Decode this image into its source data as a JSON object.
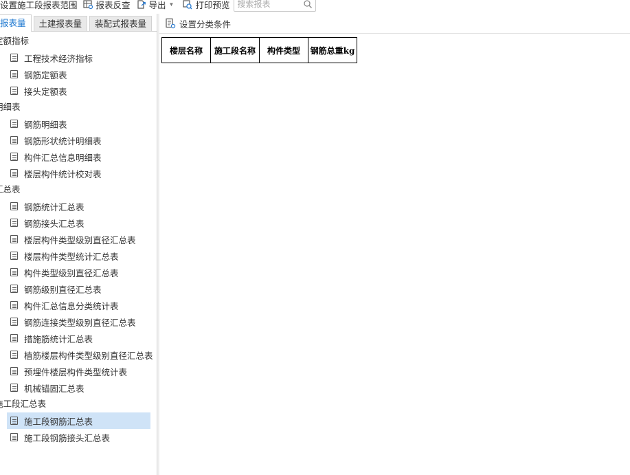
{
  "toolbar": {
    "items": [
      {
        "label": "设置施工段报表范围"
      },
      {
        "label": "报表反查",
        "icon": "grid-search-icon"
      },
      {
        "label": "导出",
        "icon": "export-icon"
      },
      {
        "label": "打印预览",
        "icon": "print-preview-icon"
      }
    ],
    "search_placeholder": "搜索报表"
  },
  "tabs": [
    {
      "label": "报表量",
      "active": true
    },
    {
      "label": "土建报表量",
      "active": false
    },
    {
      "label": "装配式报表量",
      "active": false
    }
  ],
  "tree": {
    "groups": [
      {
        "label": "定额指标",
        "items": [
          {
            "label": "工程技术经济指标"
          },
          {
            "label": "钢筋定额表"
          },
          {
            "label": "接头定额表"
          }
        ]
      },
      {
        "label": "明细表",
        "items": [
          {
            "label": "钢筋明细表"
          },
          {
            "label": "钢筋形状统计明细表"
          },
          {
            "label": "构件汇总信息明细表"
          },
          {
            "label": "楼层构件统计校对表"
          }
        ]
      },
      {
        "label": "汇总表",
        "items": [
          {
            "label": "钢筋统计汇总表"
          },
          {
            "label": "钢筋接头汇总表"
          },
          {
            "label": "楼层构件类型级别直径汇总表"
          },
          {
            "label": "楼层构件类型统计汇总表"
          },
          {
            "label": "构件类型级别直径汇总表"
          },
          {
            "label": "钢筋级别直径汇总表"
          },
          {
            "label": "构件汇总信息分类统计表"
          },
          {
            "label": "钢筋连接类型级别直径汇总表"
          },
          {
            "label": "措施筋统计汇总表"
          },
          {
            "label": "植筋楼层构件类型级别直径汇总表"
          },
          {
            "label": "预埋件楼层构件类型统计表"
          },
          {
            "label": "机械锚固汇总表"
          }
        ]
      },
      {
        "label": "施工段汇总表",
        "items": [
          {
            "label": "施工段钢筋汇总表",
            "selected": true
          },
          {
            "label": "施工段钢筋接头汇总表"
          }
        ]
      }
    ]
  },
  "right": {
    "classify_label": "设置分类条件",
    "table_headers": [
      "楼层名称",
      "施工段名称",
      "构件类型",
      "钢筋总重kg"
    ]
  },
  "colors": {
    "accent": "#1e78d0",
    "selection": "#cfe3f7"
  }
}
